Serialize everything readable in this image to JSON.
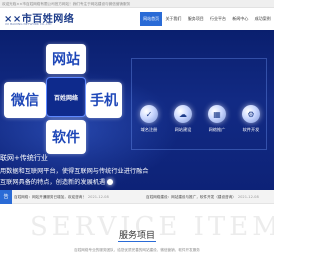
{
  "topbar": {
    "text": "欢迎光临××市百姓网络有限公司官方网站！我们专注于网站建设与微信营销服务"
  },
  "header": {
    "logo_name": "××市百姓网络",
    "logo_sub": "XX BAIXING NETWORK CO.,LTD",
    "nav": [
      "网站首页",
      "关于我们",
      "服务项目",
      "行业平台",
      "新闻中心",
      "成功案例"
    ]
  },
  "banner": {
    "puzzle": {
      "top": "网站",
      "left": "微信",
      "center": "百姓网络",
      "right": "手机",
      "bottom": "软件"
    },
    "tiles": [
      {
        "icon": "✓",
        "label": "域名注册"
      },
      {
        "icon": "☁",
        "label": "网站建设"
      },
      {
        "icon": "▦",
        "label": "网络推广"
      },
      {
        "icon": "⚙",
        "label": "软件开发"
      }
    ],
    "headline": "联网+传统行业",
    "desc1": "用数据和互联网平台，使得互联网与传统行业进行融合",
    "desc2": "互联网具备的特点，创造新的发展机遇"
  },
  "news": {
    "tag": "告",
    "items": [
      {
        "text": "百姓网络：网站开通服务已增加，欢迎咨询！",
        "date": "2021-12-08"
      },
      {
        "text": "百姓网络建设：网站建设与推广，软件开发（建设咨询）",
        "date": "2021-12-08"
      }
    ]
  },
  "services": {
    "watermark": "SERVICE ITEMS",
    "title": "服务项目",
    "subtitle": "百姓网络专业的服务团队，给您优质完善的网站建设、微信营销、软件开发服务"
  }
}
